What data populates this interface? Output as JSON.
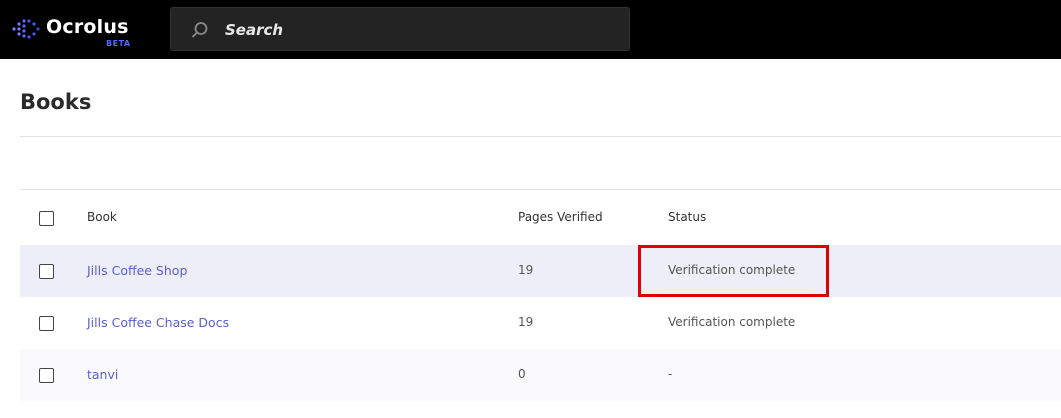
{
  "app": {
    "logo_text": "Ocrolus",
    "logo_badge": "BETA",
    "search": {
      "placeholder": "Search",
      "value": ""
    }
  },
  "page": {
    "title": "Books"
  },
  "table": {
    "columns": {
      "book": "Book",
      "pages_verified": "Pages Verified",
      "status": "Status"
    },
    "rows": [
      {
        "book": "Jills Coffee Shop",
        "pages_verified": "19",
        "status": "Verification complete",
        "highlighted": true
      },
      {
        "book": "Jills Coffee Chase Docs",
        "pages_verified": "19",
        "status": "Verification complete",
        "highlighted": false
      },
      {
        "book": "tanvi",
        "pages_verified": "0",
        "status": "-",
        "highlighted": false
      }
    ]
  },
  "colors": {
    "topbar": "#000000",
    "link": "#5b5fc7",
    "beta_badge": "#4f6bff",
    "row_highlight": "#eeeef8",
    "annotation_box": "#e00000"
  }
}
